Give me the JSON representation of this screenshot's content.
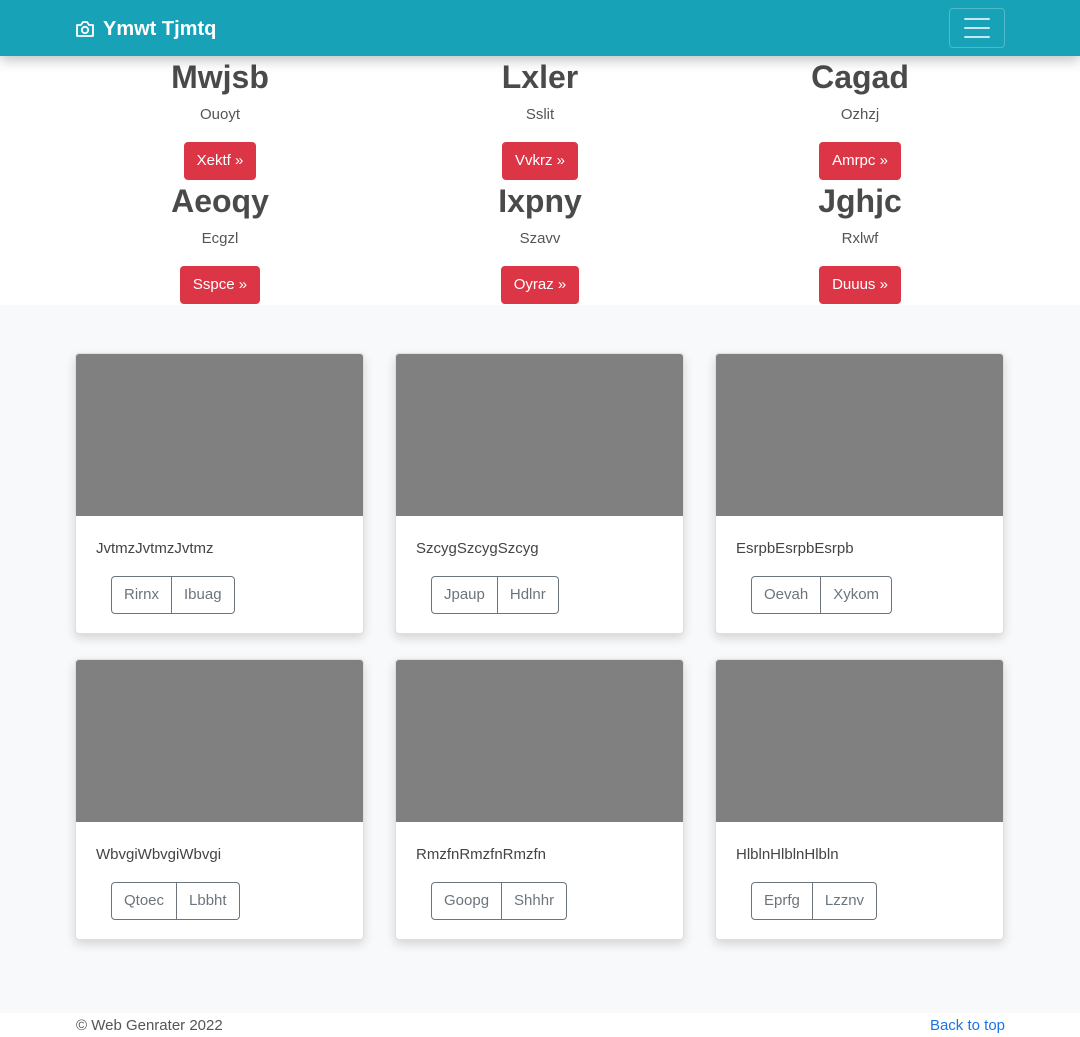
{
  "navbar": {
    "brand_icon": "camera-icon",
    "brand": "Ymwt Tjmtq",
    "toggler_icon": "menu-icon",
    "brand_color": "#17a2b8"
  },
  "features": [
    {
      "title": "Mwjsb",
      "subtitle": "Ouoyt",
      "button": "Xektf »"
    },
    {
      "title": "Lxler",
      "subtitle": "Sslit",
      "button": "Vvkrz »"
    },
    {
      "title": "Cagad",
      "subtitle": "Ozhzj",
      "button": "Amrpc »"
    },
    {
      "title": "Aeoqy",
      "subtitle": "Ecgzl",
      "button": "Sspce »"
    },
    {
      "title": "Ixpny",
      "subtitle": "Szavv",
      "button": "Oyraz »"
    },
    {
      "title": "Jghjc",
      "subtitle": "Rxlwf",
      "button": "Duuus »"
    }
  ],
  "cards": [
    {
      "text": "JvtmzJvtmzJvtmz",
      "btn1": "Rirnx",
      "btn2": "Ibuag"
    },
    {
      "text": "SzcygSzcygSzcyg",
      "btn1": "Jpaup",
      "btn2": "Hdlnr"
    },
    {
      "text": "EsrpbEsrpbEsrpb",
      "btn1": "Oevah",
      "btn2": "Xykom"
    },
    {
      "text": "WbvgiWbvgiWbvgi",
      "btn1": "Qtoec",
      "btn2": "Lbbht"
    },
    {
      "text": "RmzfnRmzfnRmzfn",
      "btn1": "Goopg",
      "btn2": "Shhhr"
    },
    {
      "text": "HlblnHlblnHlbln",
      "btn1": "Eprfg",
      "btn2": "Lzznv"
    }
  ],
  "footer": {
    "copyright": "© Web Genrater 2022",
    "back_to_top": "Back to top"
  },
  "colors": {
    "accent": "#17a2b8",
    "danger": "#dc3545",
    "thumbnail": "#808080",
    "link": "#1a73e8"
  }
}
